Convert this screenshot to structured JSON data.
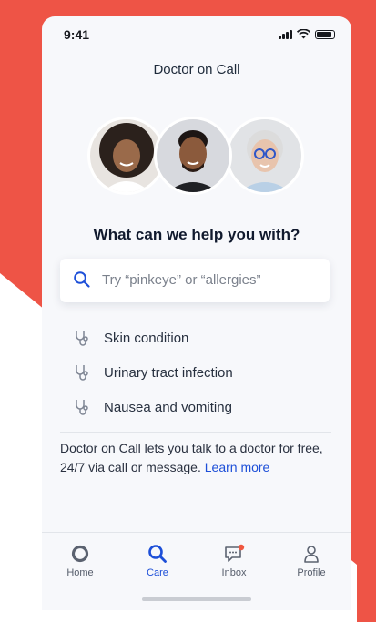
{
  "status_bar": {
    "time": "9:41"
  },
  "header": {
    "title": "Doctor on Call"
  },
  "main": {
    "question": "What can we help you with?",
    "search": {
      "placeholder": "Try “pinkeye” or “allergies”",
      "icon": "search-icon"
    },
    "conditions": [
      {
        "label": "Skin condition",
        "icon": "stethoscope-icon"
      },
      {
        "label": "Urinary tract infection",
        "icon": "stethoscope-icon"
      },
      {
        "label": "Nausea and vomiting",
        "icon": "stethoscope-icon"
      }
    ],
    "info_text": "Doctor on Call lets you talk to a doctor for free, 24/7 via call or message.",
    "learn_more": "Learn more"
  },
  "tabs": [
    {
      "label": "Home",
      "icon": "home-icon",
      "active": false
    },
    {
      "label": "Care",
      "icon": "search-icon",
      "active": true
    },
    {
      "label": "Inbox",
      "icon": "chat-icon",
      "active": false,
      "badge": true
    },
    {
      "label": "Profile",
      "icon": "person-icon",
      "active": false
    }
  ],
  "colors": {
    "background_red": "#ee5446",
    "accent_blue": "#1d4fd8",
    "badge_orange": "#f0573f"
  }
}
